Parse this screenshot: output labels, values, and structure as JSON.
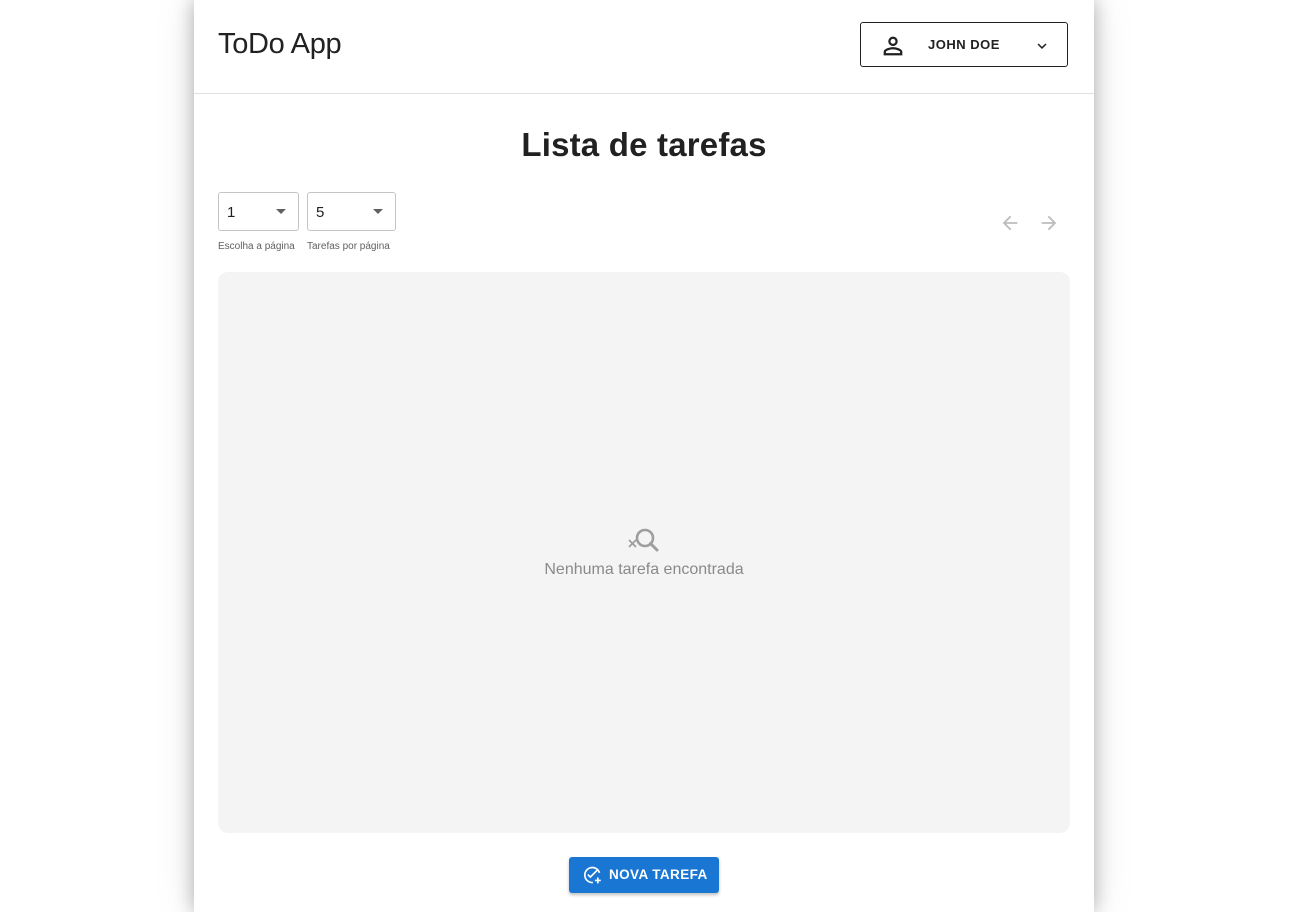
{
  "header": {
    "app_title": "ToDo App",
    "user": {
      "name": "JOHN DOE",
      "icon": "person-outline-icon",
      "dropdown_icon": "chevron-down-icon"
    }
  },
  "main": {
    "title": "Lista de tarefas",
    "page_select": {
      "value": "1",
      "helper": "Escolha a página"
    },
    "per_page_select": {
      "value": "5",
      "helper": "Tarefas por página"
    },
    "pagination": {
      "prev_icon": "arrow-left-icon",
      "next_icon": "arrow-right-icon"
    },
    "empty_state": {
      "icon": "search-off-icon",
      "message": "Nenhuma tarefa encontrada"
    },
    "new_task_button": {
      "label": "NOVA TAREFA",
      "icon": "add-task-icon"
    }
  },
  "colors": {
    "primary": "#1976d2",
    "panel_bg": "#f4f4f4",
    "muted_text": "#8a8a8a",
    "disabled_icon": "#bdbdbd"
  }
}
